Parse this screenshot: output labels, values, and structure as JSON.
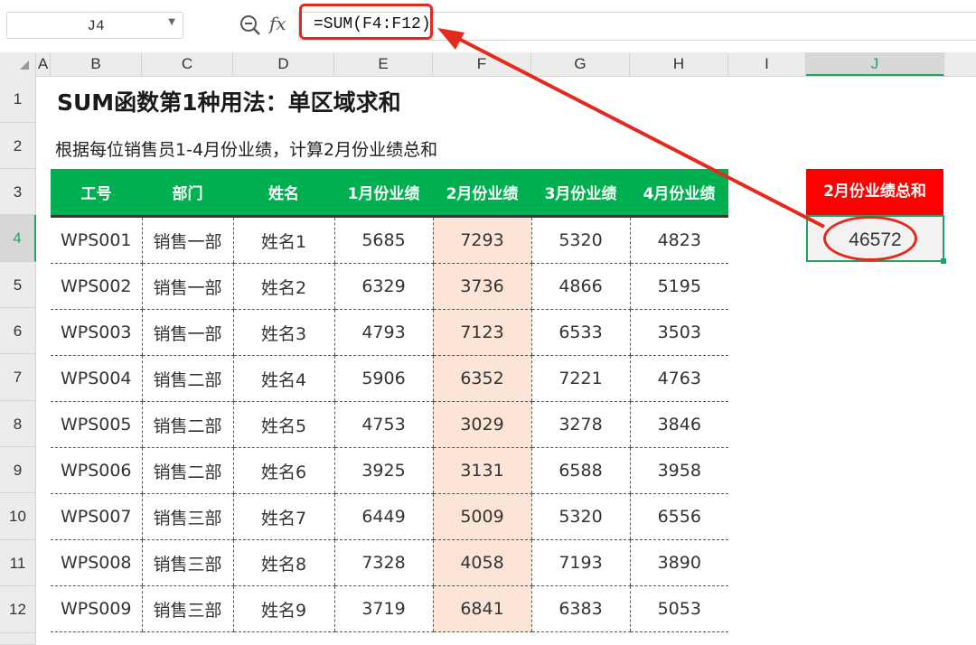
{
  "formula_bar": {
    "cell_ref": "J4",
    "fx_label": "fx",
    "formula": "=SUM(F4:F12)"
  },
  "columns": [
    "A",
    "B",
    "C",
    "D",
    "E",
    "F",
    "G",
    "H",
    "I",
    "J"
  ],
  "active_column": "J",
  "rows": [
    "1",
    "2",
    "3",
    "4",
    "5",
    "6",
    "7",
    "8",
    "9",
    "10",
    "11",
    "12"
  ],
  "active_row": "4",
  "sheet": {
    "title": "SUM函数第1种用法：单区域求和",
    "subtitle": "根据每位销售员1-4月份业绩，计算2月份业绩总和",
    "table": {
      "headers": [
        "工号",
        "部门",
        "姓名",
        "1月份业绩",
        "2月份业绩",
        "3月份业绩",
        "4月份业绩"
      ],
      "rows": [
        [
          "WPS001",
          "销售一部",
          "姓名1",
          "5685",
          "7293",
          "5320",
          "4823"
        ],
        [
          "WPS002",
          "销售一部",
          "姓名2",
          "6329",
          "3736",
          "4866",
          "5195"
        ],
        [
          "WPS003",
          "销售一部",
          "姓名3",
          "4793",
          "7123",
          "6533",
          "3503"
        ],
        [
          "WPS004",
          "销售二部",
          "姓名4",
          "5906",
          "6352",
          "7221",
          "4763"
        ],
        [
          "WPS005",
          "销售二部",
          "姓名5",
          "4753",
          "3029",
          "3278",
          "3846"
        ],
        [
          "WPS006",
          "销售二部",
          "姓名6",
          "3925",
          "3131",
          "6588",
          "3958"
        ],
        [
          "WPS007",
          "销售三部",
          "姓名7",
          "6449",
          "5009",
          "5320",
          "6556"
        ],
        [
          "WPS008",
          "销售三部",
          "姓名8",
          "7328",
          "4058",
          "7193",
          "3890"
        ],
        [
          "WPS009",
          "销售三部",
          "姓名9",
          "3719",
          "6841",
          "6383",
          "5053"
        ]
      ]
    },
    "sum": {
      "header": "2月份业绩总和",
      "value": "46572"
    }
  },
  "colors": {
    "header_green": "#00b050",
    "sum_header_red": "#ff0000",
    "highlight_column": "#fce4d6",
    "annotation_red": "#e42a1d",
    "selection_green": "#21a366"
  }
}
